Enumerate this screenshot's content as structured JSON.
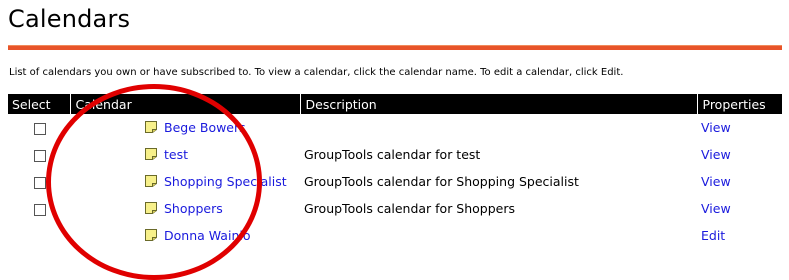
{
  "page": {
    "title": "Calendars",
    "intro": "List of calendars you own or have subscribed to. To view a calendar, click the calendar name. To edit a calendar, click Edit."
  },
  "table": {
    "headers": {
      "select": "Select",
      "calendar": "Calendar",
      "description": "Description",
      "properties": "Properties"
    },
    "rows": [
      {
        "name": "Bege Bowers",
        "description": "",
        "property": "View",
        "has_checkbox": true
      },
      {
        "name": "test",
        "description": "GroupTools calendar for test",
        "property": "View",
        "has_checkbox": true
      },
      {
        "name": "Shopping Specialist",
        "description": "GroupTools calendar for Shopping Specialist",
        "property": "View",
        "has_checkbox": true
      },
      {
        "name": "Shoppers",
        "description": "GroupTools calendar for Shoppers",
        "property": "View",
        "has_checkbox": true
      },
      {
        "name": "Donna Wainio",
        "description": "",
        "property": "Edit",
        "has_checkbox": false
      }
    ]
  },
  "icons": {
    "calendar_row": "calendar-page-icon",
    "annotation": "red-circle-annotation"
  },
  "colors": {
    "accent_rule": "#e8542a",
    "link": "#1a1add",
    "header_bg": "#000000",
    "annotation": "#e00000"
  }
}
